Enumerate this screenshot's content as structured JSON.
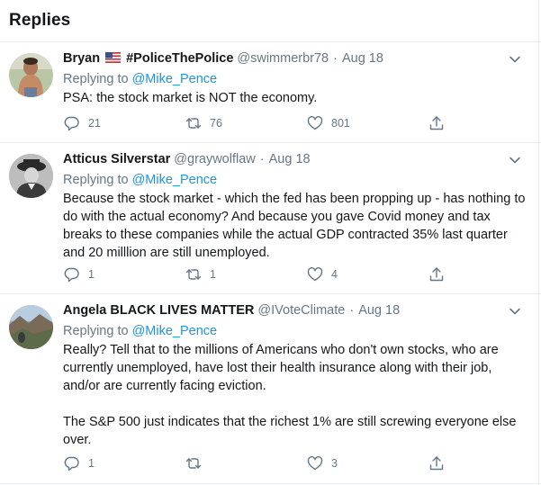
{
  "header": {
    "title": "Replies"
  },
  "colors": {
    "link": "#1b95e0",
    "muted": "#657786",
    "text": "#14171a",
    "border": "#e6ecf0"
  },
  "tweets": [
    {
      "author": "Bryan",
      "flag_icon": "us-flag-icon",
      "name_suffix": "#PoliceThePolice",
      "handle": "@swimmerbr78",
      "separator": "·",
      "date": "Aug 18",
      "replying_label": "Replying to",
      "replying_to": "@Mike_Pence",
      "text": "PSA: the stock market is NOT the economy.",
      "replies": "21",
      "retweets": "76",
      "likes": "801"
    },
    {
      "author": "Atticus Silverstar",
      "handle": "@graywolflaw",
      "separator": "·",
      "date": "Aug 18",
      "replying_label": "Replying to",
      "replying_to": "@Mike_Pence",
      "text": "Because the stock market - which the fed has been propping up - has nothing to do with the actual economy?   And because you gave Covid money and tax breaks to these companies while the actual GDP contracted 35% last quarter and 20 milllion are still unemployed.",
      "replies": "1",
      "retweets": "1",
      "likes": "4"
    },
    {
      "author": "Angela BLACK LIVES MATTER",
      "handle": "@IVoteClimate",
      "separator": "·",
      "date": "Aug 18",
      "replying_label": "Replying to",
      "replying_to": "@Mike_Pence",
      "text": "Really? Tell that to the millions of Americans who don't own stocks, who are currently unemployed, have lost their health insurance along with their job, and/or are currently facing eviction.\n\nThe S&P 500 just indicates that the richest 1% are still screwing everyone else over.",
      "replies": "1",
      "retweets": "",
      "likes": "3"
    }
  ]
}
